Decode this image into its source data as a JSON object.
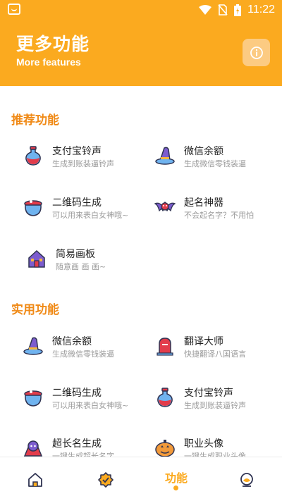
{
  "status_bar": {
    "time": "11:22"
  },
  "header": {
    "title": "更多功能",
    "subtitle": "More features"
  },
  "sections": [
    {
      "title": "推荐功能",
      "items": [
        {
          "name": "支付宝铃声",
          "desc": "生成到账装逼铃声",
          "icon": "potion-icon"
        },
        {
          "name": "微信余额",
          "desc": "生成微信零钱装逼",
          "icon": "wizard-hat-icon"
        },
        {
          "name": "二维码生成",
          "desc": "可以用来表白女神哦~",
          "icon": "cauldron-icon"
        },
        {
          "name": "起名神器",
          "desc": "不会起名字？不用怕",
          "icon": "bat-icon"
        },
        {
          "name": "简易画板",
          "desc": "随意画 画 画~",
          "icon": "haunted-house-icon"
        }
      ]
    },
    {
      "title": "实用功能",
      "items": [
        {
          "name": "微信余额",
          "desc": "生成微信零钱装逼",
          "icon": "wizard-hat-icon"
        },
        {
          "name": "翻译大师",
          "desc": "快捷翻译八国语言",
          "icon": "tombstone-icon"
        },
        {
          "name": "二维码生成",
          "desc": "可以用来表白女神哦~",
          "icon": "cauldron-icon"
        },
        {
          "name": "支付宝铃声",
          "desc": "生成到账装逼铃声",
          "icon": "potion-icon"
        },
        {
          "name": "超长名生成",
          "desc": "一键生成超长名字",
          "icon": "vampire-icon"
        },
        {
          "name": "职业头像",
          "desc": "一键生成职业头像",
          "icon": "pumpkin-icon"
        }
      ]
    }
  ],
  "bottom_nav": {
    "active_label": "功能",
    "items": [
      "home-icon",
      "badge-check-icon",
      "features-tab",
      "profile-icon"
    ]
  },
  "colors": {
    "accent": "#fbaa1f",
    "section_title": "#f08a17",
    "description": "#9a9a9a"
  }
}
